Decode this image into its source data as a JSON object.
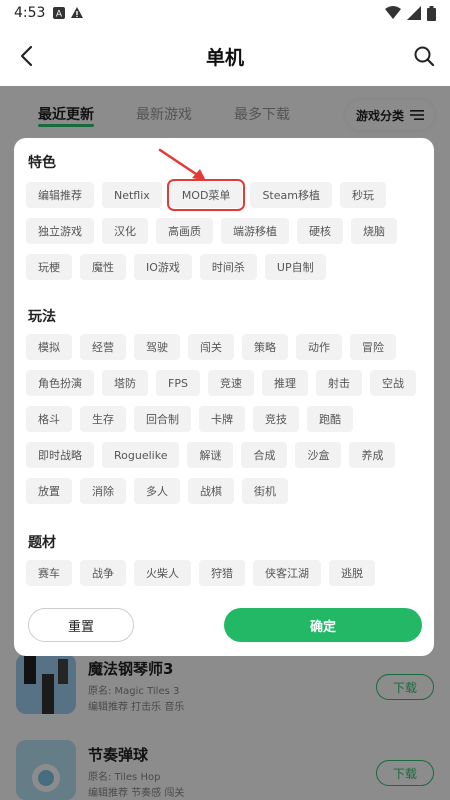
{
  "status_bar": {
    "time": "4:53"
  },
  "header": {
    "title": "单机"
  },
  "tabs": [
    {
      "label": "最近更新"
    },
    {
      "label": "最新游戏"
    },
    {
      "label": "最多下载"
    }
  ],
  "filter_button": {
    "label": "游戏分类"
  },
  "filter_panel": {
    "sections": [
      {
        "title": "特色",
        "tags": [
          "编辑推荐",
          "Netflix",
          "MOD菜单",
          "Steam移植",
          "秒玩",
          "独立游戏",
          "汉化",
          "高画质",
          "端游移植",
          "硬核",
          "烧脑",
          "玩梗",
          "魔性",
          "IO游戏",
          "时间杀",
          "UP自制"
        ]
      },
      {
        "title": "玩法",
        "tags": [
          "模拟",
          "经营",
          "驾驶",
          "闯关",
          "策略",
          "动作",
          "冒险",
          "角色扮演",
          "塔防",
          "FPS",
          "竞速",
          "推理",
          "射击",
          "空战",
          "格斗",
          "生存",
          "回合制",
          "卡牌",
          "竞技",
          "跑酷",
          "即时战略",
          "Roguelike",
          "解谜",
          "合成",
          "沙盒",
          "养成",
          "放置",
          "消除",
          "多人",
          "战棋",
          "街机"
        ]
      },
      {
        "title": "题材",
        "tags": [
          "赛车",
          "战争",
          "火柴人",
          "狩猎",
          "侠客江湖",
          "逃脱"
        ]
      }
    ],
    "highlighted_tag": "MOD菜单",
    "reset_label": "重置",
    "confirm_label": "确定"
  },
  "games": [
    {
      "name": "魔法钢琴师3",
      "original_name": "原名: Magic Tiles 3",
      "tags": "编辑推荐  打击乐  音乐",
      "download_label": "下载"
    },
    {
      "name": "节奏弹球",
      "original_name": "原名: Tiles Hop",
      "tags": "编辑推荐  节奏感  闯关",
      "download_label": "下载"
    }
  ],
  "colors": {
    "accent": "#22b866",
    "highlight_border": "#e53935",
    "arrow": "#e53935"
  }
}
